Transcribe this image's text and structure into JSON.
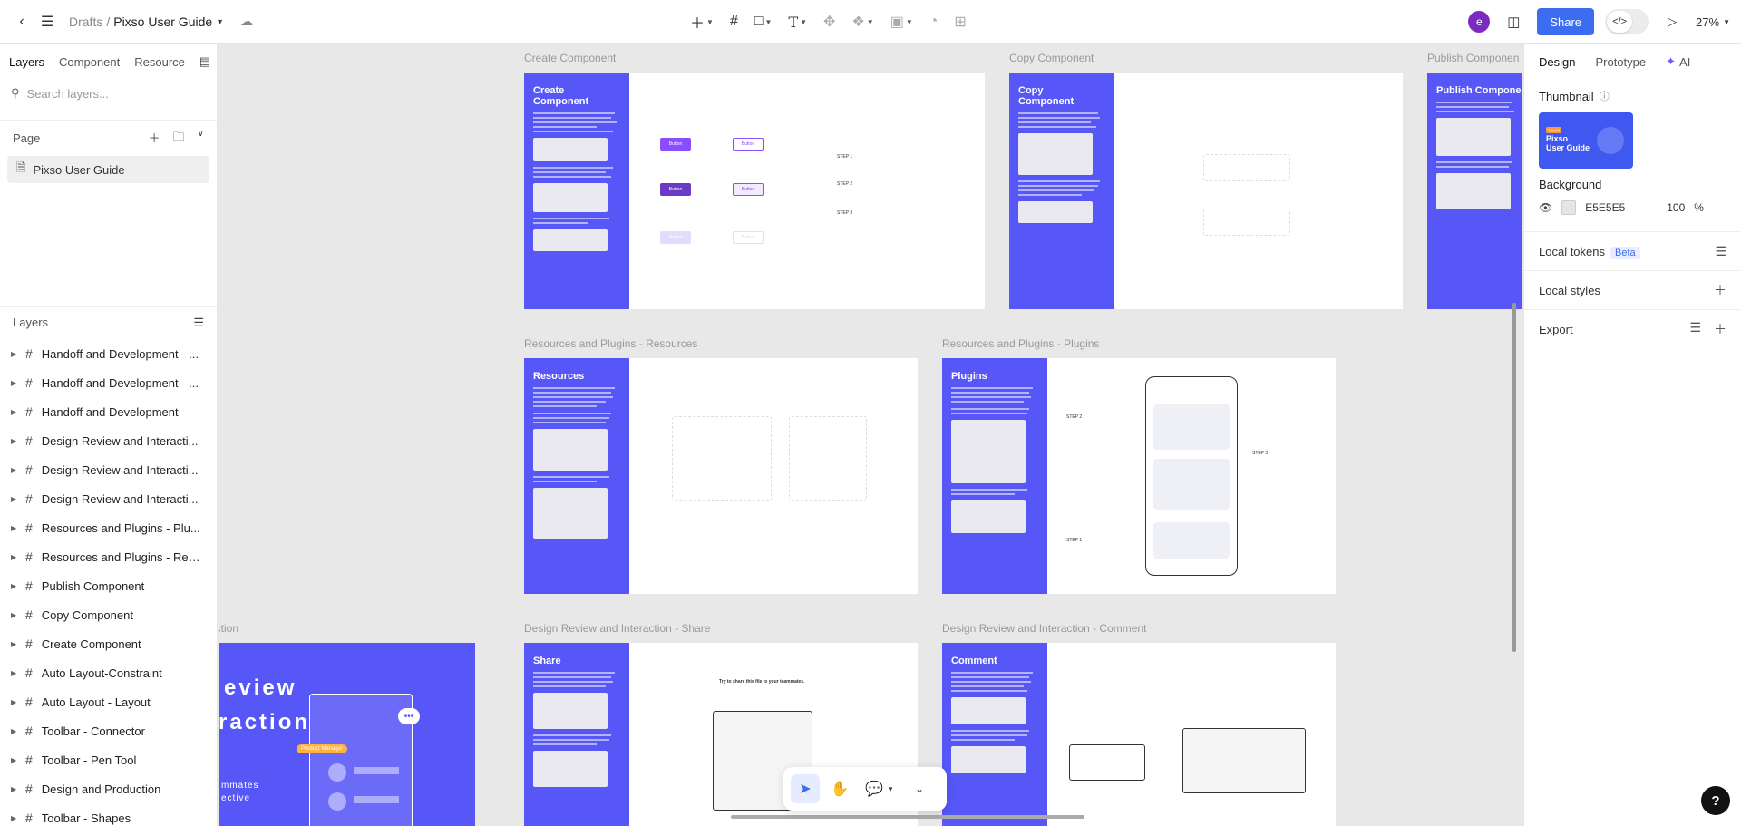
{
  "topbar": {
    "breadcrumb_root": "Drafts",
    "breadcrumb_sep": "/",
    "file_name": "Pixso User Guide",
    "avatar_initial": "e",
    "share_label": "Share",
    "zoom": "27%",
    "dev_mode_icon": "</>"
  },
  "left": {
    "tabs": [
      "Layers",
      "Component",
      "Resource"
    ],
    "search_placeholder": "Search layers...",
    "page_header": "Page",
    "page_item": "Pixso User Guide",
    "layers_header": "Layers",
    "layers": [
      "Handoff and Development - ...",
      "Handoff and Development - ...",
      "Handoff and Development",
      "Design Review and Interacti...",
      "Design Review and Interacti...",
      "Design Review and Interacti...",
      "Resources and Plugins - Plu...",
      "Resources and Plugins - Res...",
      "Publish Component",
      "Copy Component",
      "Create Component",
      "Auto Layout-Constraint",
      "Auto Layout - Layout",
      "Toolbar - Connector",
      "Toolbar - Pen Tool",
      "Design and Production",
      "Toolbar - Shapes"
    ]
  },
  "right": {
    "tabs": [
      "Design",
      "Prototype",
      "AI"
    ],
    "thumbnail_label": "Thumbnail",
    "thumb_tag": "Tutorial",
    "thumb_text": "Pixso\nUser Guide",
    "background_label": "Background",
    "bg_hex": "E5E5E5",
    "bg_opacity": "100",
    "bg_pct": "%",
    "local_tokens": "Local tokens",
    "beta": "Beta",
    "local_styles": "Local styles",
    "export": "Export"
  },
  "canvas": {
    "labels": {
      "create": "Create Component",
      "copy": "Copy Component",
      "publish": "Publish Componen",
      "res": "Resources and Plugins - Resources",
      "plugins": "Resources and Plugins - Plugins",
      "share": "Design Review and Interaction - Share",
      "comment": "Design Review and Interaction - Comment",
      "left_partial": "action"
    },
    "titles": {
      "create": "Create\nComponent",
      "copy": "Copy\nComponent",
      "publish": "Publish Componen",
      "res": "Resources",
      "plugins": "Plugins",
      "share": "Share",
      "comment": "Comment",
      "big1": "eview",
      "big2": "raction",
      "big3": "mmates",
      "big4": "ective",
      "pm_tag": "Product Manager"
    },
    "create_chips": [
      "Button",
      "Button",
      "Button",
      "Button",
      "Button",
      "Button"
    ],
    "create_steps": [
      "STEP 1",
      "STEP 2",
      "STEP 3"
    ],
    "share_hint": "Try to share this file to your teammates.",
    "plugins_steps": [
      "STEP 2",
      "STEP 3",
      "STEP 1"
    ]
  },
  "colors": {
    "accent": "#3c6df0",
    "frame_side": "#5757f8",
    "canvas_bg": "#e8e8e8"
  }
}
